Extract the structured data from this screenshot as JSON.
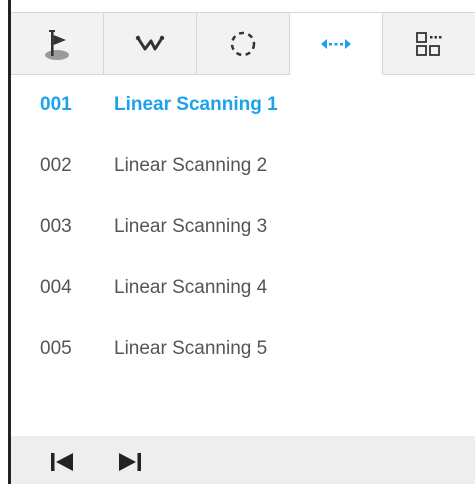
{
  "tabs": [
    {
      "icon": "flag-icon",
      "active": false
    },
    {
      "icon": "pattern-icon",
      "active": false
    },
    {
      "icon": "tour-circle-icon",
      "active": false
    },
    {
      "icon": "linear-scan-icon",
      "active": true
    },
    {
      "icon": "grid-more-icon",
      "active": false
    }
  ],
  "items": [
    {
      "num": "001",
      "label": "Linear Scanning 1",
      "selected": true
    },
    {
      "num": "002",
      "label": "Linear Scanning 2",
      "selected": false
    },
    {
      "num": "003",
      "label": "Linear Scanning 3",
      "selected": false
    },
    {
      "num": "004",
      "label": "Linear Scanning 4",
      "selected": false
    },
    {
      "num": "005",
      "label": "Linear Scanning 5",
      "selected": false
    }
  ],
  "footer": {
    "prev_icon": "skip-first-icon",
    "next_icon": "skip-last-icon"
  },
  "colors": {
    "accent": "#1aa3ea",
    "icon": "#333333",
    "text": "#555555"
  }
}
